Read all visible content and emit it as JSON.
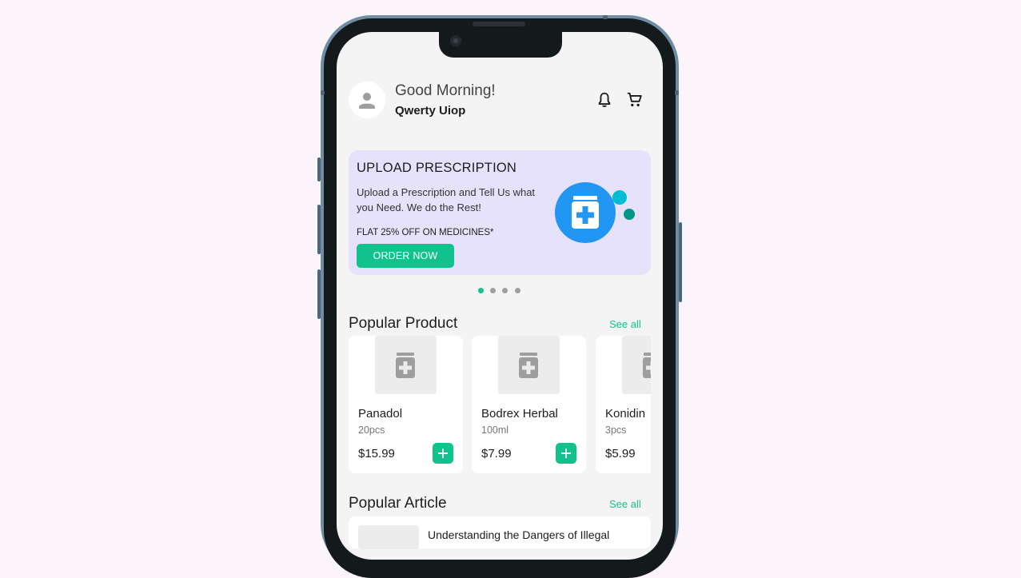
{
  "header": {
    "greeting": "Good Morning!",
    "user_name": "Qwerty Uiop",
    "icons": [
      "user-icon",
      "bell-icon",
      "cart-icon"
    ]
  },
  "banner": {
    "title": "UPLOAD PRESCRIPTION",
    "description": "Upload a Prescription and Tell Us what you Need. We do the Rest!",
    "promo": "FLAT 25% OFF ON MEDICINES*",
    "button_label": "ORDER NOW",
    "icon": "medicine-bottle-icon",
    "carousel_pages": 4,
    "active_page": 1
  },
  "popular_product": {
    "title": "Popular Product",
    "see_all": "See all",
    "items": [
      {
        "name": "Panadol",
        "quantity": "20pcs",
        "price": "$15.99"
      },
      {
        "name": "Bodrex Herbal",
        "quantity": "100ml",
        "price": "$7.99"
      },
      {
        "name": "Konidin",
        "quantity": "3pcs",
        "price": "$5.99"
      }
    ]
  },
  "popular_article": {
    "title": "Popular Article",
    "see_all": "See all",
    "first_article_title": "Understanding the Dangers of Illegal"
  },
  "colors": {
    "accent": "#11c28d",
    "banner_bg": "#e6e2fc",
    "badge_blue": "#2196f3",
    "bubble_cyan": "#00bcd4",
    "bubble_teal": "#009688"
  }
}
